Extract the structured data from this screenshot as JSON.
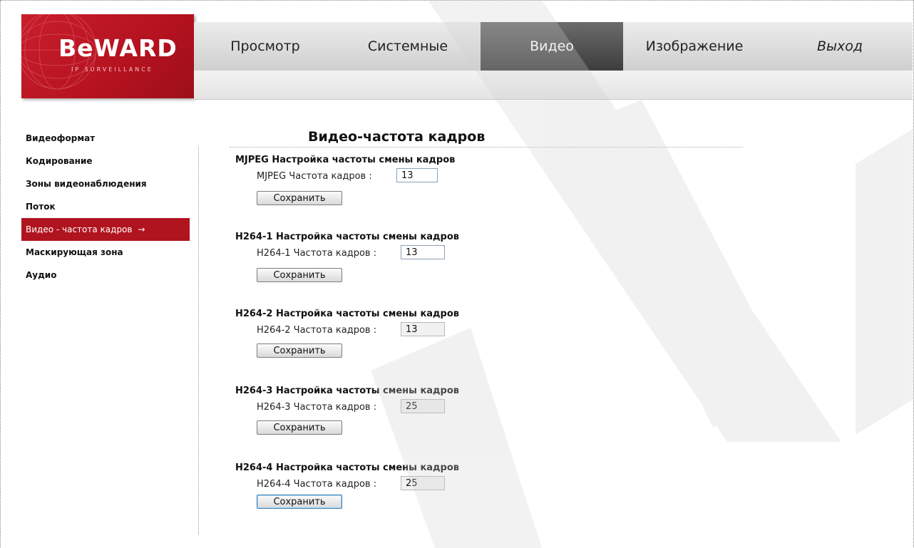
{
  "brand": {
    "logo_text": "BeWARD",
    "logo_tagline": "IP SURVEILLANCE"
  },
  "nav": {
    "items": [
      {
        "label": "Просмотр"
      },
      {
        "label": "Системные"
      },
      {
        "label": "Видео",
        "active": true
      },
      {
        "label": "Изображение"
      },
      {
        "label": "Выход"
      }
    ]
  },
  "sidebar": {
    "items": [
      {
        "label": "Видеоформат"
      },
      {
        "label": "Кодирование"
      },
      {
        "label": "Зоны видеонаблюдения"
      },
      {
        "label": "Поток"
      },
      {
        "label": "Видео - частота кадров",
        "active": true,
        "arrow": "→"
      },
      {
        "label": "Маскирующая зона"
      },
      {
        "label": "Аудио"
      }
    ]
  },
  "main": {
    "title": "Видео-частота кадров",
    "sections": [
      {
        "heading": "MJPEG Настройка частоты смены кадров",
        "label": "MJPEG Частота кадров :",
        "value": "13",
        "button": "Сохранить",
        "input_enabled": true
      },
      {
        "heading": "H264-1 Настройка частоты смены кадров",
        "label": "H264-1 Частота кадров :",
        "value": "13",
        "button": "Сохранить",
        "input_enabled": true
      },
      {
        "heading": "H264-2 Настройка частоты смены кадров",
        "label": "H264-2 Частота кадров :",
        "value": "13",
        "button": "Сохранить",
        "input_enabled": false
      },
      {
        "heading": "H264-3 Настройка частоты смены кадров",
        "label": "H264-3 Частота кадров :",
        "value": "25",
        "button": "Сохранить",
        "input_enabled": false
      },
      {
        "heading": "H264-4 Настройка частоты смены кадров",
        "label": "H264-4 Частота кадров :",
        "value": "25",
        "button": "Сохранить",
        "input_enabled": false
      }
    ]
  },
  "colors": {
    "brand_red": "#b0141f",
    "nav_active": "#4a4a4a",
    "watermark": "#d9d9d9"
  }
}
